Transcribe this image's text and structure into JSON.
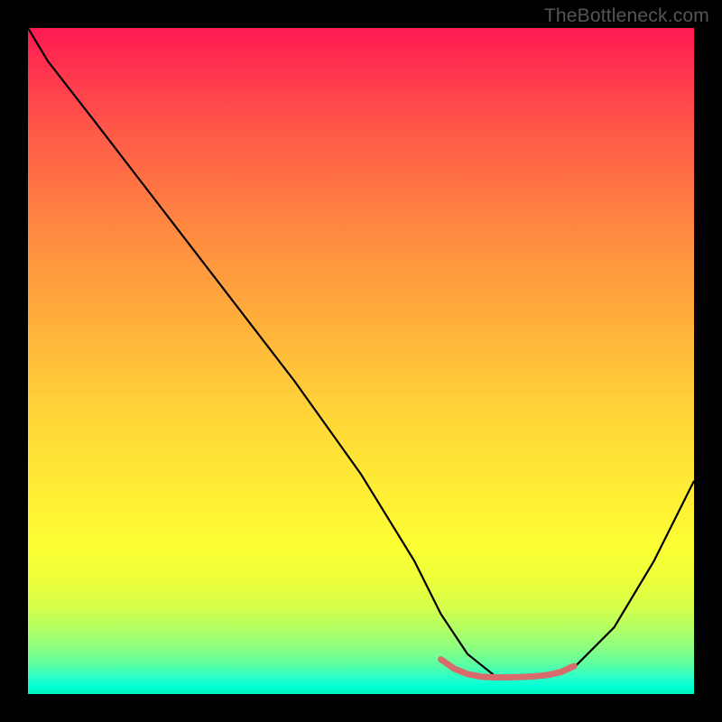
{
  "watermark": "TheBottleneck.com",
  "chart_data": {
    "type": "line",
    "title": "",
    "xlabel": "",
    "ylabel": "",
    "xlim": [
      0,
      100
    ],
    "ylim": [
      0,
      100
    ],
    "grid": false,
    "series": [
      {
        "name": "curve",
        "color": "#000000",
        "x": [
          0,
          3,
          10,
          20,
          30,
          40,
          50,
          58,
          62,
          66,
          70,
          75,
          78,
          82,
          88,
          94,
          100
        ],
        "y": [
          100,
          95,
          86,
          73,
          60,
          47,
          33,
          20,
          12,
          6,
          2.8,
          2.5,
          2.8,
          4,
          10,
          20,
          32
        ]
      },
      {
        "name": "highlight",
        "color": "#d86b6b",
        "stroke_width": 7,
        "x": [
          62,
          64,
          66,
          68,
          70,
          72,
          74,
          76,
          78,
          80,
          82
        ],
        "y": [
          5.2,
          3.8,
          3.0,
          2.6,
          2.5,
          2.5,
          2.55,
          2.65,
          2.85,
          3.3,
          4.2
        ]
      }
    ],
    "background": {
      "type": "vertical-gradient",
      "stops": [
        {
          "pos": 0,
          "color": "#ff1a52"
        },
        {
          "pos": 0.5,
          "color": "#ffba3a"
        },
        {
          "pos": 0.78,
          "color": "#fcff34"
        },
        {
          "pos": 0.93,
          "color": "#8cff80"
        },
        {
          "pos": 1.0,
          "color": "#00f7b8"
        }
      ]
    }
  }
}
